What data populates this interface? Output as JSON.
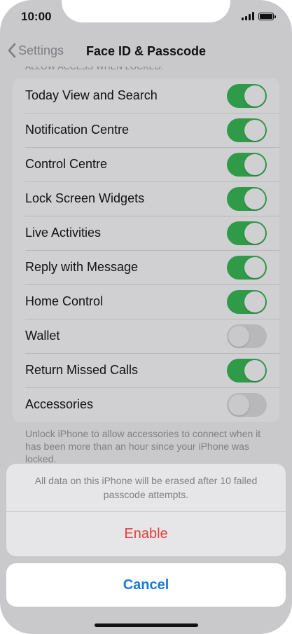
{
  "status_bar": {
    "time": "10:00"
  },
  "nav": {
    "back_label": "Settings",
    "title": "Face ID & Passcode"
  },
  "section": {
    "header": "ALLOW ACCESS WHEN LOCKED:",
    "items": [
      {
        "label": "Today View and Search",
        "on": true
      },
      {
        "label": "Notification Centre",
        "on": true
      },
      {
        "label": "Control Centre",
        "on": true
      },
      {
        "label": "Lock Screen Widgets",
        "on": true
      },
      {
        "label": "Live Activities",
        "on": true
      },
      {
        "label": "Reply with Message",
        "on": true
      },
      {
        "label": "Home Control",
        "on": true
      },
      {
        "label": "Wallet",
        "on": false
      },
      {
        "label": "Return Missed Calls",
        "on": true
      },
      {
        "label": "Accessories",
        "on": false
      }
    ],
    "footer": "Unlock iPhone to allow accessories to connect when it has been more than an hour since your iPhone was locked."
  },
  "action_sheet": {
    "message": "All data on this iPhone will be erased after 10 failed passcode attempts.",
    "enable_label": "Enable",
    "cancel_label": "Cancel"
  },
  "colors": {
    "toggle_on": "#2f9a47",
    "destructive": "#e2403b",
    "accent": "#1a7ad9"
  }
}
